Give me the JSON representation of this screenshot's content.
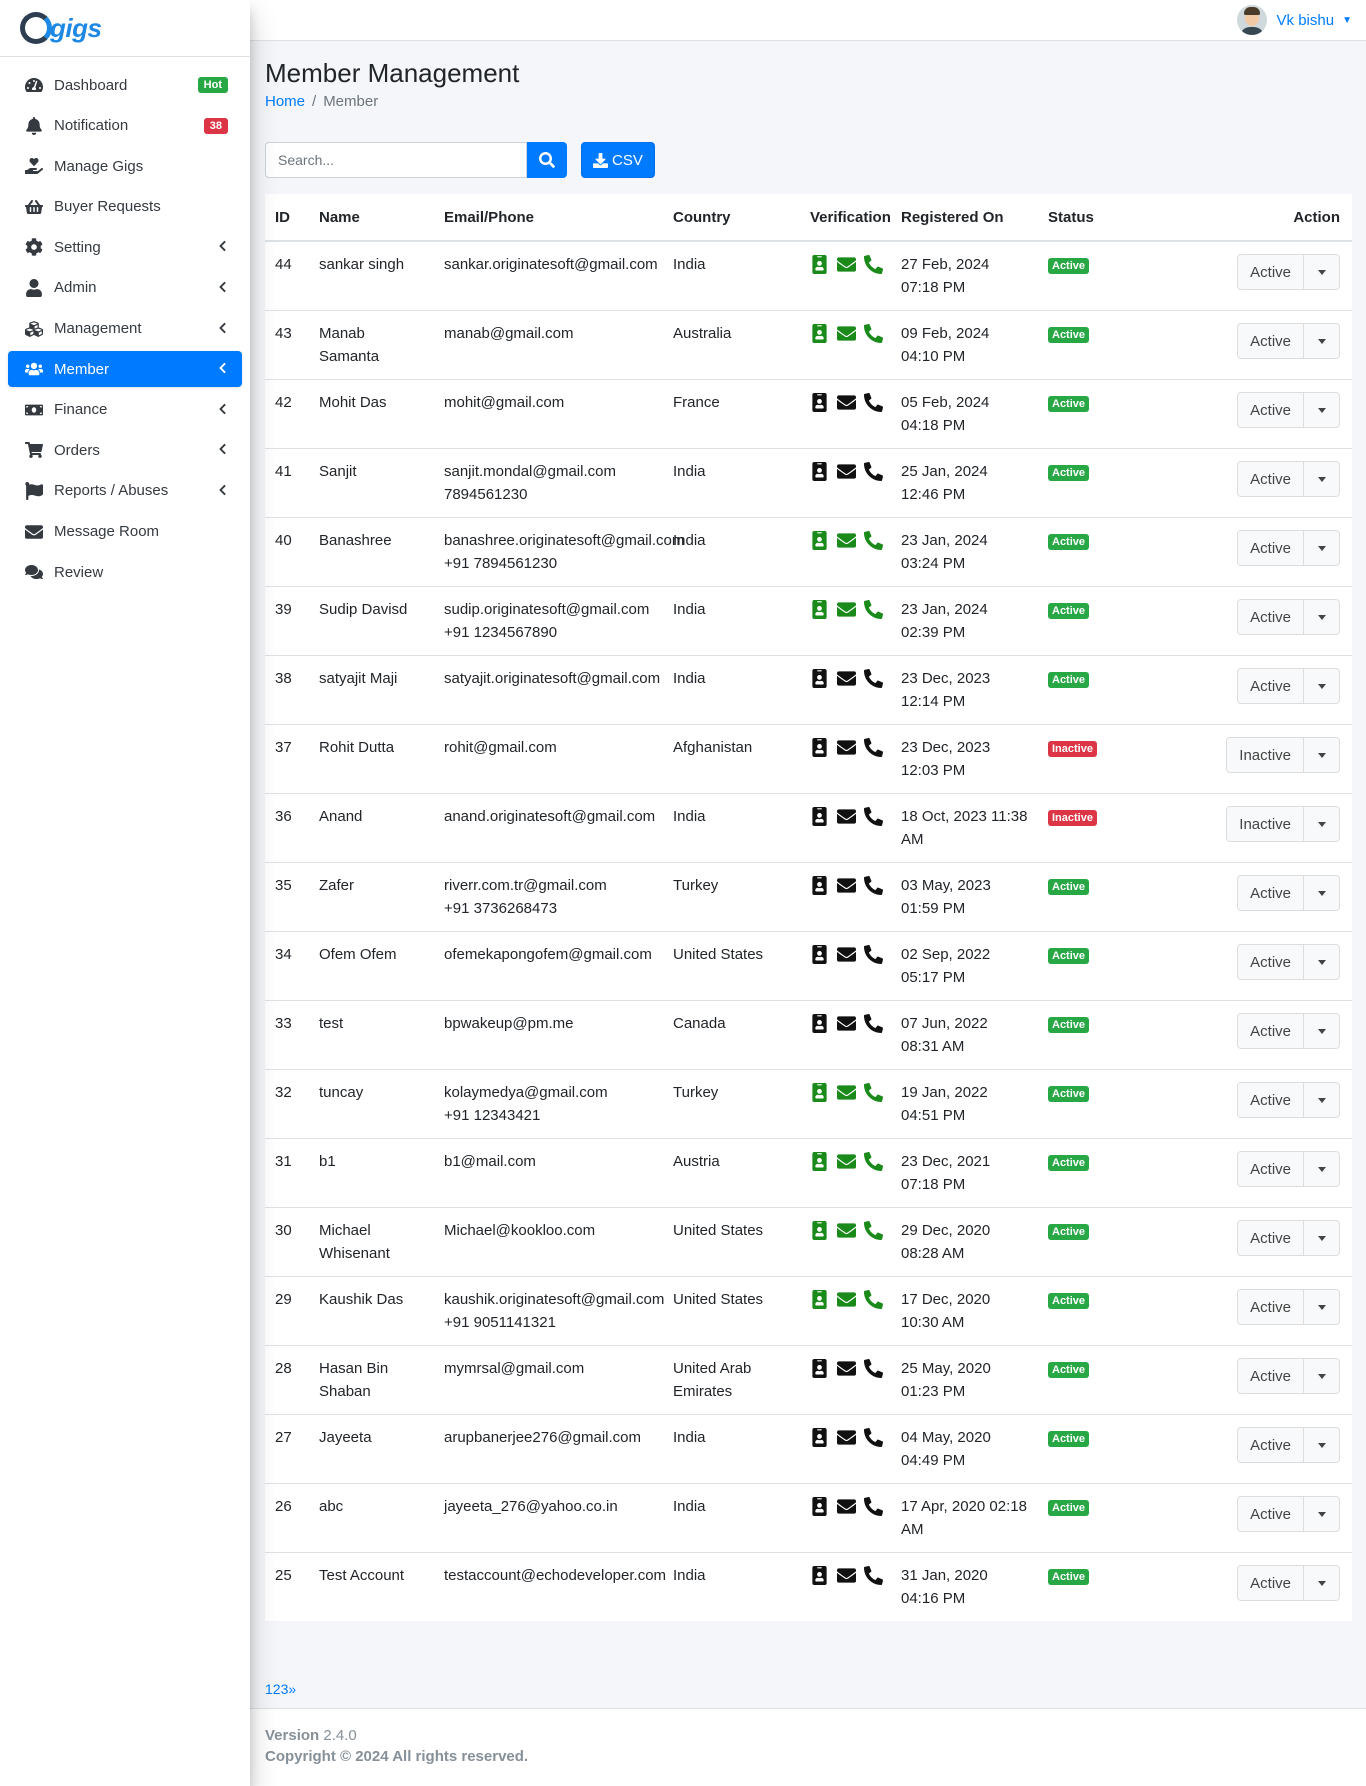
{
  "brand": {
    "name": "gigs"
  },
  "sidebar": {
    "items": [
      {
        "label": "Dashboard",
        "icon": "tachometer-icon",
        "badge": "Hot"
      },
      {
        "label": "Notification",
        "icon": "bell-icon",
        "badge": "38"
      },
      {
        "label": "Manage Gigs",
        "icon": "hand-holding-heart-icon"
      },
      {
        "label": "Buyer Requests",
        "icon": "shopping-basket-icon"
      },
      {
        "label": "Setting",
        "icon": "gear-icon",
        "has_children": true
      },
      {
        "label": "Admin",
        "icon": "user-icon",
        "has_children": true
      },
      {
        "label": "Management",
        "icon": "cubes-icon",
        "has_children": true
      },
      {
        "label": "Member",
        "icon": "users-icon",
        "has_children": true,
        "active": true
      },
      {
        "label": "Finance",
        "icon": "money-bill-icon",
        "has_children": true
      },
      {
        "label": "Orders",
        "icon": "cart-icon",
        "has_children": true
      },
      {
        "label": "Reports / Abuses",
        "icon": "flag-icon",
        "has_children": true
      },
      {
        "label": "Message Room",
        "icon": "envelope-icon"
      },
      {
        "label": "Review",
        "icon": "comments-icon"
      }
    ]
  },
  "topbar": {
    "user_name": "Vk bishu"
  },
  "page": {
    "title": "Member Management",
    "breadcrumb": {
      "home": "Home",
      "current": "Member"
    }
  },
  "toolbar": {
    "search_placeholder": "Search...",
    "csv_label": "CSV"
  },
  "table": {
    "headers": [
      "ID",
      "Name",
      "Email/Phone",
      "Country",
      "Verification",
      "Registered On",
      "Status",
      "Action"
    ],
    "rows": [
      {
        "id": "44",
        "name": "sankar singh",
        "email": "sankar.originatesoft@gmail.com",
        "phone": "",
        "country": "India",
        "verified": true,
        "registered": "27 Feb, 2024 07:18 PM",
        "status": "Active"
      },
      {
        "id": "43",
        "name": "Manab Samanta",
        "email": "manab@gmail.com",
        "phone": "",
        "country": "Australia",
        "verified": true,
        "registered": "09 Feb, 2024 04:10 PM",
        "status": "Active"
      },
      {
        "id": "42",
        "name": "Mohit Das",
        "email": "mohit@gmail.com",
        "phone": "",
        "country": "France",
        "verified": false,
        "registered": "05 Feb, 2024 04:18 PM",
        "status": "Active"
      },
      {
        "id": "41",
        "name": "Sanjit",
        "email": "sanjit.mondal@gmail.com",
        "phone": "7894561230",
        "country": "India",
        "verified": false,
        "registered": "25 Jan, 2024 12:46 PM",
        "status": "Active"
      },
      {
        "id": "40",
        "name": "Banashree",
        "email": "banashree.originatesoft@gmail.com",
        "phone": "+91 7894561230",
        "country": "India",
        "verified": true,
        "registered": "23 Jan, 2024 03:24 PM",
        "status": "Active"
      },
      {
        "id": "39",
        "name": "Sudip Davisd",
        "email": "sudip.originatesoft@gmail.com",
        "phone": "+91 1234567890",
        "country": "India",
        "verified": true,
        "registered": "23 Jan, 2024 02:39 PM",
        "status": "Active"
      },
      {
        "id": "38",
        "name": "satyajit Maji",
        "email": "satyajit.originatesoft@gmail.com",
        "phone": "",
        "country": "India",
        "verified": false,
        "registered": "23 Dec, 2023 12:14 PM",
        "status": "Active"
      },
      {
        "id": "37",
        "name": "Rohit Dutta",
        "email": "rohit@gmail.com",
        "phone": "",
        "country": "Afghanistan",
        "verified": false,
        "registered": "23 Dec, 2023 12:03 PM",
        "status": "Inactive"
      },
      {
        "id": "36",
        "name": "Anand",
        "email": "anand.originatesoft@gmail.com",
        "phone": "",
        "country": "India",
        "verified": false,
        "registered": "18 Oct, 2023 11:38 AM",
        "status": "Inactive"
      },
      {
        "id": "35",
        "name": "Zafer",
        "email": "riverr.com.tr@gmail.com",
        "phone": "+91 3736268473",
        "country": "Turkey",
        "verified": false,
        "registered": "03 May, 2023 01:59 PM",
        "status": "Active"
      },
      {
        "id": "34",
        "name": "Ofem Ofem",
        "email": "ofemekapongofem@gmail.com",
        "phone": "",
        "country": "United States",
        "verified": false,
        "registered": "02 Sep, 2022 05:17 PM",
        "status": "Active"
      },
      {
        "id": "33",
        "name": "test",
        "email": "bpwakeup@pm.me",
        "phone": "",
        "country": "Canada",
        "verified": false,
        "registered": "07 Jun, 2022 08:31 AM",
        "status": "Active"
      },
      {
        "id": "32",
        "name": "tuncay",
        "email": "kolaymedya@gmail.com",
        "phone": "+91 12343421",
        "country": "Turkey",
        "verified": true,
        "registered": "19 Jan, 2022 04:51 PM",
        "status": "Active"
      },
      {
        "id": "31",
        "name": "b1",
        "email": "b1@mail.com",
        "phone": "",
        "country": "Austria",
        "verified": true,
        "registered": "23 Dec, 2021 07:18 PM",
        "status": "Active"
      },
      {
        "id": "30",
        "name": "Michael Whisenant",
        "email": "Michael@kookloo.com",
        "phone": "",
        "country": "United States",
        "verified": true,
        "registered": "29 Dec, 2020 08:28 AM",
        "status": "Active"
      },
      {
        "id": "29",
        "name": "Kaushik Das",
        "email": "kaushik.originatesoft@gmail.com",
        "phone": "+91 9051141321",
        "country": "United States",
        "verified": true,
        "registered": "17 Dec, 2020 10:30 AM",
        "status": "Active"
      },
      {
        "id": "28",
        "name": "Hasan Bin Shaban",
        "email": "mymrsal@gmail.com",
        "phone": "",
        "country": "United Arab Emirates",
        "verified": false,
        "registered": "25 May, 2020 01:23 PM",
        "status": "Active"
      },
      {
        "id": "27",
        "name": "Jayeeta",
        "email": "arupbanerjee276@gmail.com",
        "phone": "",
        "country": "India",
        "verified": false,
        "registered": "04 May, 2020 04:49 PM",
        "status": "Active"
      },
      {
        "id": "26",
        "name": "abc",
        "email": "jayeeta_276@yahoo.co.in",
        "phone": "",
        "country": "India",
        "verified": false,
        "registered": "17 Apr, 2020 02:18 AM",
        "status": "Active"
      },
      {
        "id": "25",
        "name": "Test Account",
        "email": "testaccount@echodeveloper.com",
        "phone": "",
        "country": "India",
        "verified": false,
        "registered": "31 Jan, 2020 04:16 PM",
        "status": "Active"
      }
    ]
  },
  "pagination": {
    "text": "123»"
  },
  "footer": {
    "version_label": "Version",
    "version": "2.4.0",
    "copyright": "Copyright © 2024 All rights reserved."
  },
  "colors": {
    "primary": "#007bff",
    "verified": "#1a8a1a",
    "active": "#28a745",
    "inactive": "#dc3545"
  }
}
